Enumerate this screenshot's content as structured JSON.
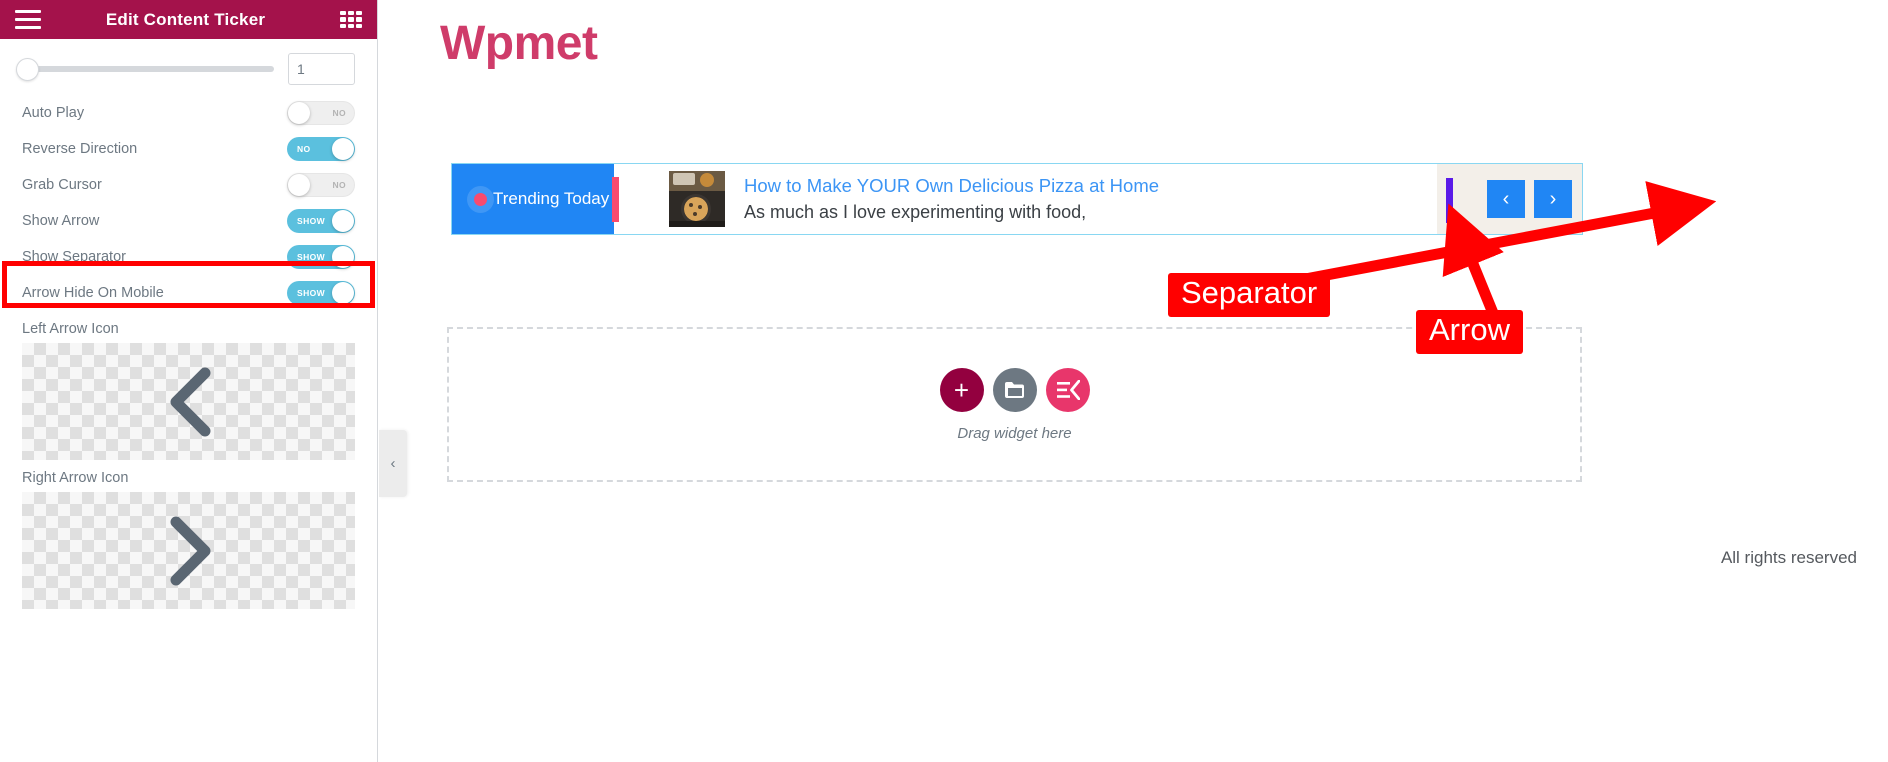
{
  "panel": {
    "header": {
      "title": "Edit Content Ticker",
      "menu_icon": "hamburger-icon",
      "grid_icon": "grid-icon"
    },
    "slider": {
      "value": "1"
    },
    "switches": [
      {
        "label": "Auto Play",
        "state": "off",
        "text": "NO"
      },
      {
        "label": "Reverse Direction",
        "state": "on",
        "text": "NO"
      },
      {
        "label": "Grab Cursor",
        "state": "off",
        "text": "NO"
      },
      {
        "label": "Show Arrow",
        "state": "on",
        "text": "SHOW"
      },
      {
        "label": "Show Separator",
        "state": "on",
        "text": "SHOW"
      },
      {
        "label": "Arrow Hide On Mobile",
        "state": "on",
        "text": "SHOW"
      }
    ],
    "left_arrow_icon": {
      "label": "Left Arrow Icon",
      "glyph": "chevron-left"
    },
    "right_arrow_icon": {
      "label": "Right Arrow Icon",
      "glyph": "chevron-right"
    }
  },
  "canvas": {
    "logo": "Wpmet",
    "collapse_handle": "‹",
    "ticker": {
      "badge_label": "Trending Today",
      "title": "How to Make YOUR Own Delicious Pizza at Home",
      "description": "As much as I love experimenting with food,",
      "prev_arrow": "‹",
      "next_arrow": "›"
    },
    "dropzone": {
      "text": "Drag widget here",
      "add_button": "+",
      "folder_button": "folder-icon",
      "ekit_button": "elementskit-icon"
    },
    "footer": "All rights reserved"
  },
  "annotations": [
    {
      "id": "separator",
      "label": "Separator"
    },
    {
      "id": "arrow",
      "label": "Arrow"
    }
  ],
  "colors": {
    "panel_header": "#a4124b",
    "switch_on": "#5bc0de",
    "ticker_badge": "#2086f4",
    "ticker_accent": "#f94b6e",
    "separator": "#5a1ae8",
    "annotation": "#ff0000",
    "logo": "#cf3c6a"
  }
}
